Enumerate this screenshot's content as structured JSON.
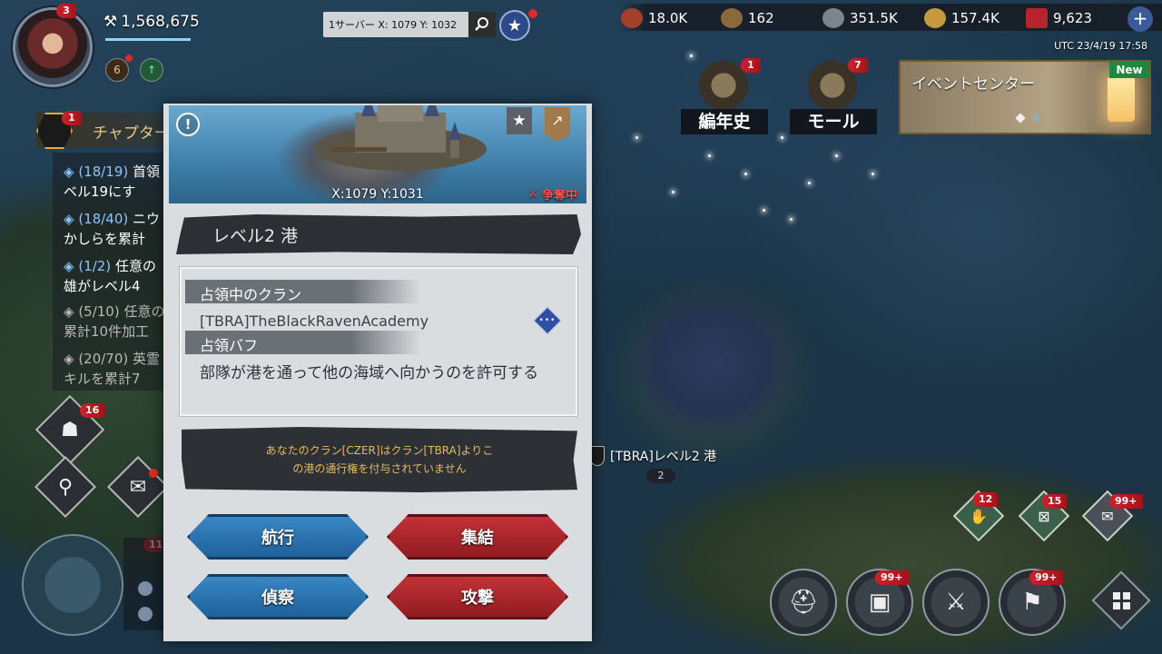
{
  "profile": {
    "avatar_badge": "3",
    "power_icon": "crossed-tools-icon",
    "power": "1,568,675",
    "level_badge": "6"
  },
  "coords_bar": {
    "text": "1サーバー X:  1079 Y:  1032"
  },
  "resources": [
    {
      "icon": "meat-icon",
      "value": "18.0K",
      "color": "#a4402a"
    },
    {
      "icon": "wood-icon",
      "value": "162",
      "color": "#8a6a3a"
    },
    {
      "icon": "iron-icon",
      "value": "351.5K",
      "color": "#7c848c"
    },
    {
      "icon": "gold-icon",
      "value": "157.4K",
      "color": "#c49a3a"
    },
    {
      "icon": "crystal-icon",
      "value": "9,623",
      "color": "#b8242c"
    }
  ],
  "utc_time": "UTC 23/4/19 17:58",
  "features": [
    {
      "label": "編年史",
      "badge": "1"
    },
    {
      "label": "モール",
      "badge": "7"
    }
  ],
  "event_center": {
    "title": "イベントセンター",
    "new_tag": "New"
  },
  "chapter": {
    "label": "チャプター",
    "badge": "1"
  },
  "quests": [
    {
      "progress": "(18/19)",
      "line1": "首領",
      "line2": "ベル19にす",
      "dim": false
    },
    {
      "progress": "(18/40)",
      "line1": "ニウ",
      "line2": "かしらを累計",
      "dim": false
    },
    {
      "progress": "(1/2)",
      "line1": "任意の",
      "line2": "雄がレベル4",
      "dim": false
    },
    {
      "progress": "(5/10)",
      "line1": "任意の",
      "line2": "累計10件加工",
      "dim": true
    },
    {
      "progress": "(20/70)",
      "line1": "英霊",
      "line2": "キルを累計7",
      "dim": true
    }
  ],
  "left_buttons": {
    "scout_badge": "16",
    "emblem_badge": "11"
  },
  "popup": {
    "coords": "X:1079 Y:1031",
    "status": "争奪中",
    "title": "レベル2 港",
    "occupying_clan_label": "占領中のクラン",
    "occupying_clan": "[TBRA]TheBlackRavenAcademy",
    "buff_label": "占領バフ",
    "buff_text": "部隊が港を通って他の海域へ向かうのを許可する",
    "warning": "あなたのクラン[CZER]はクラン[TBRA]よりこの港の通行権を付与されていません",
    "buttons": {
      "sail": "航行",
      "rally": "集結",
      "scout": "偵察",
      "attack": "攻撃"
    }
  },
  "map_label": {
    "name": "[TBRA]レベル2 港",
    "level": "2"
  },
  "bottom_right": {
    "handshake_badge": "12",
    "scroll_badge": "15",
    "mail_badge": "99+",
    "chest_badge": "99+",
    "banner_badge": "99+"
  }
}
